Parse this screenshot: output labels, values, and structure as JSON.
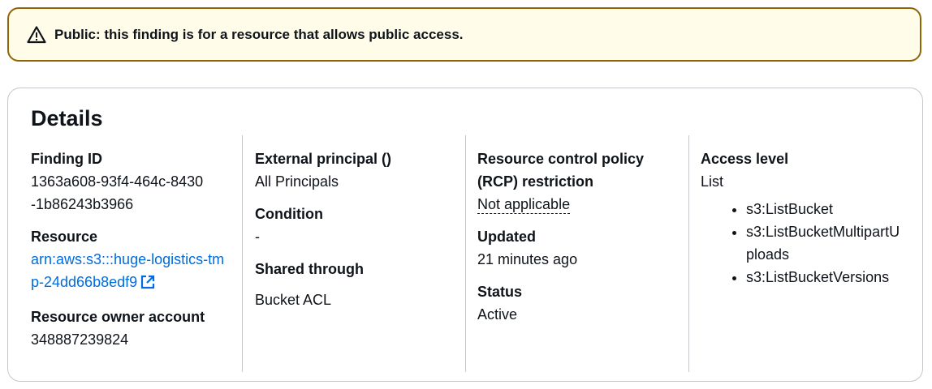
{
  "alert": {
    "icon": "warning-icon",
    "text": "Public: this finding is for a resource that allows public access."
  },
  "details": {
    "title": "Details",
    "finding_id_label": "Finding ID",
    "finding_id_value": "1363a608-93f4-464c-8430-1b86243b3966",
    "resource_label": "Resource",
    "resource_value": "arn:aws:s3:::huge-logistics-tmp-24dd66b8edf9",
    "resource_owner_label": "Resource owner account",
    "resource_owner_value": "348887239824",
    "external_principal_label": "External principal ()",
    "external_principal_value": "All Principals",
    "condition_label": "Condition",
    "condition_value": "-",
    "shared_through_label": "Shared through",
    "shared_through_value": "Bucket ACL",
    "rcp_label": "Resource control policy (RCP) restriction",
    "rcp_value": "Not applicable",
    "updated_label": "Updated",
    "updated_value": "21 minutes ago",
    "status_label": "Status",
    "status_value": "Active",
    "access_level_label": "Access level",
    "access_level_value": "List",
    "actions": [
      "s3:ListBucket",
      "s3:ListBucketMultipartUploads",
      "s3:ListBucketVersions"
    ]
  },
  "colors": {
    "alert_border": "#8d6605",
    "alert_bg": "#fffce9",
    "link": "#006ce0",
    "divider": "#c6c6cd"
  }
}
